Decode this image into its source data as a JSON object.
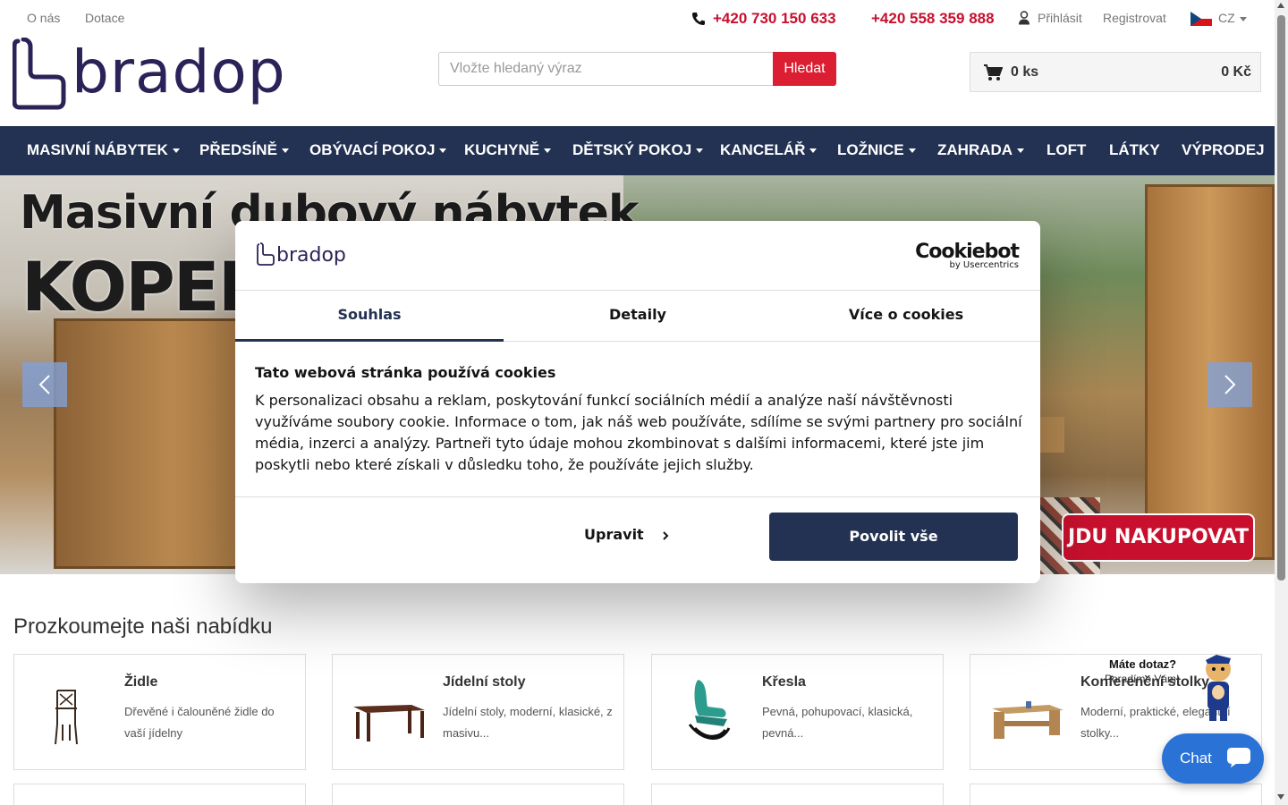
{
  "topbar": {
    "links": [
      "O nás",
      "Dotace"
    ],
    "phones": [
      "+420 730 150 633",
      "+420 558 359 888"
    ],
    "login": "Přihlásit",
    "register": "Registrovat",
    "language": "CZ"
  },
  "header": {
    "logo_text": "bradop",
    "search": {
      "placeholder": "Vložte hledaný výraz",
      "button": "Hledat"
    },
    "cart": {
      "count": "0 ks",
      "total": "0 Kč"
    }
  },
  "nav": {
    "items": [
      {
        "label": "MASIVNÍ NÁBYTEK",
        "dropdown": true
      },
      {
        "label": "PŘEDSÍNĚ",
        "dropdown": true
      },
      {
        "label": "OBÝVACÍ POKOJ",
        "dropdown": true
      },
      {
        "label": "KUCHYNĚ",
        "dropdown": true
      },
      {
        "label": "DĚTSKÝ POKOJ",
        "dropdown": true
      },
      {
        "label": "KANCELÁŘ",
        "dropdown": true
      },
      {
        "label": "LOŽNICE",
        "dropdown": true
      },
      {
        "label": "ZAHRADA",
        "dropdown": true
      },
      {
        "label": "LOFT",
        "dropdown": false
      },
      {
        "label": "LÁTKY",
        "dropdown": false
      },
      {
        "label": "VÝPRODEJ",
        "dropdown": false
      }
    ]
  },
  "hero": {
    "title_line1": "Masivní dubový nábytek",
    "title_line2": "KOPENH",
    "cta": "JDU NAKUPOVAT"
  },
  "section": {
    "title": "Prozkoumejte naši nabídku",
    "cards": [
      {
        "title": "Židle",
        "desc": "Dřevěné i čalouněné židle do vaší jídelny",
        "icon": "chair-image"
      },
      {
        "title": "Jídelní stoly",
        "desc": "Jídelní stoly, moderní, klasické, z masivu...",
        "icon": "dining-table-image"
      },
      {
        "title": "Křesla",
        "desc": "Pevná, pohupovací, klasická, pevná...",
        "icon": "armchair-image"
      },
      {
        "title": "Konferenční stolky",
        "desc": "Moderní, praktické, elegantní stolky...",
        "icon": "coffee-table-image"
      }
    ]
  },
  "cookie": {
    "logo_text": "bradop",
    "brand": "Cookiebot",
    "brand_sub": "by Usercentrics",
    "tabs": [
      "Souhlas",
      "Detaily",
      "Více o cookies"
    ],
    "active_tab": 0,
    "heading": "Tato webová stránka používá cookies",
    "body": "K personalizaci obsahu a reklam, poskytování funkcí sociálních médií a analýze naší návštěvnosti využíváme soubory cookie. Informace o tom, jak náš web používáte, sdílíme se svými partnery pro sociální média, inzerci a analýzy. Partneři tyto údaje mohou zkombinovat s dalšími informacemi, které jste jim poskytli nebo které získali v důsledku toho, že používáte jejich služby.",
    "customize": "Upravit",
    "allow_all": "Povolit vše"
  },
  "chat": {
    "question": "Máte dotaz?",
    "subtitle": "Poradíme Vám!",
    "label": "Chat"
  },
  "colors": {
    "brand_navy": "#233252",
    "accent_red": "#dc1e32",
    "chat_blue": "#2b72d6",
    "logo_purple": "#2b2358"
  }
}
